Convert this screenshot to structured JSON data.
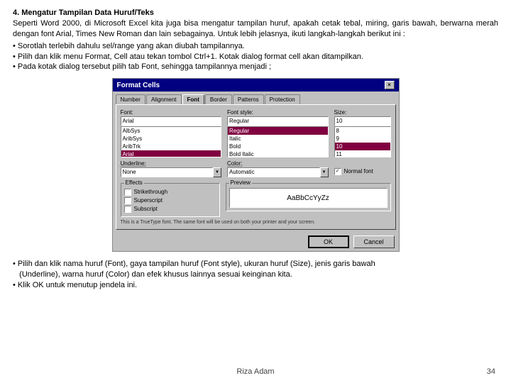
{
  "heading": "4. Mengatur Tampilan Data Huruf/Teks",
  "para1": "Seperti Word 2000, di Microsoft Excel kita juga bisa mengatur tampilan huruf, apakah cetak tebal, miring, garis bawah, berwarna merah dengan font Arial, Times New Roman dan lain sebagainya. Untuk lebih jelasnya, ikuti langkah-langkah berikut ini :",
  "b1": "• Sorotlah terlebih dahulu sel/range yang akan diubah tampilannya.",
  "b2": "• Pilih dan klik menu Format, Cell atau tekan tombol Ctrl+1. Kotak dialog format cell akan ditampilkan.",
  "b3": "• Pada kotak dialog tersebut pilih tab Font, sehingga tampilannya menjadi ;",
  "dialog": {
    "title": "Format Cells",
    "tabs": {
      "number": "Number",
      "alignment": "Alignment",
      "font": "Font",
      "border": "Border",
      "patterns": "Patterns",
      "protection": "Protection"
    },
    "font_label": "Font:",
    "font_value": "Arial",
    "font_list": {
      "i0": "AlbSys",
      "i1": "AribSys",
      "i2": "AribTrk",
      "i3": "Arial"
    },
    "style_label": "Font style:",
    "style_value": "Regular",
    "style_list": {
      "i0": "Regular",
      "i1": "Italic",
      "i2": "Bold",
      "i3": "Bold Italic"
    },
    "size_label": "Size:",
    "size_value": "10",
    "size_list": {
      "i0": "8",
      "i1": "9",
      "i2": "10",
      "i3": "11"
    },
    "underline_label": "Underline:",
    "underline_value": "None",
    "color_label": "Color:",
    "color_value": "Automatic",
    "normal_font": "Normal font",
    "effects_label": "Effects",
    "fx_strike": "Strikethrough",
    "fx_super": "Superscript",
    "fx_sub": "Subscript",
    "preview_label": "Preview",
    "preview_text": "AaBbCcYyZz",
    "note": "This is a TrueType font. The same font will be used on both your printer and your screen.",
    "ok": "OK",
    "cancel": "Cancel"
  },
  "after1": "• Pilih dan klik nama huruf (Font), gaya tampilan huruf (Font style), ukuran huruf (Size), jenis garis bawah",
  "after2": "   (Underline), warna huruf (Color) dan efek khusus lainnya sesuai keinginan kita.",
  "after3": "• Klik OK untuk menutup jendela ini.",
  "author": "Riza Adam",
  "page": "34"
}
